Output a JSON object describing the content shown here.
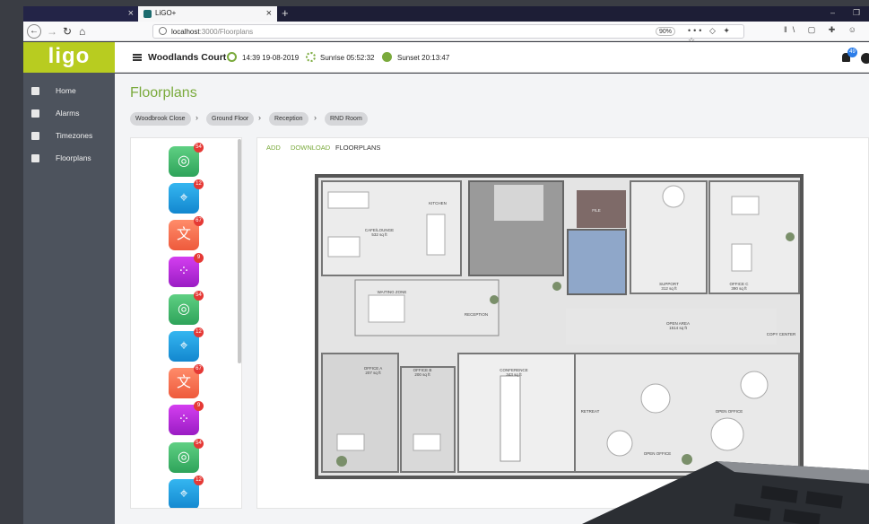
{
  "browser": {
    "tab_title": "LiGO+",
    "url_host": "localhost",
    "url_path": ":3000/Floorplans",
    "zoom": "90%"
  },
  "sidebar": {
    "logo": "ligo",
    "items": [
      {
        "label": "Home"
      },
      {
        "label": "Alarms"
      },
      {
        "label": "Timezones"
      },
      {
        "label": "Floorplans"
      }
    ]
  },
  "header": {
    "site_name": "Woodlands Court",
    "time": "14:39 19-08-2019",
    "sunrise": "Sunrise 05:52:32",
    "sunset": "Sunset 20:13:47",
    "notification_count": "49"
  },
  "main": {
    "title": "Floorplans",
    "breadcrumbs": [
      "Woodbrook Close",
      "Ground Floor",
      "Reception",
      "RND Room"
    ],
    "tabs": [
      "ADD",
      "DOWNLOAD",
      "FLOORPLANS"
    ],
    "colors": {
      "accent": "#7aaa3c",
      "logo_bg": "#b8cc20",
      "sidebar_bg": "#4d535d"
    },
    "devices": [
      {
        "type": "fingerprint",
        "icon": "fingerprint-icon",
        "badge": "54"
      },
      {
        "type": "wireless",
        "icon": "wireless-reader-icon",
        "badge": "12"
      },
      {
        "type": "translate",
        "icon": "translate-icon",
        "badge": "67"
      },
      {
        "type": "keypad",
        "icon": "keypad-icon",
        "badge": "9"
      },
      {
        "type": "fingerprint",
        "icon": "fingerprint-icon",
        "badge": "54"
      },
      {
        "type": "wireless",
        "icon": "wireless-reader-icon",
        "badge": "12"
      },
      {
        "type": "translate",
        "icon": "translate-icon",
        "badge": "67"
      },
      {
        "type": "keypad",
        "icon": "keypad-icon",
        "badge": "9"
      },
      {
        "type": "fingerprint",
        "icon": "fingerprint-icon",
        "badge": "54"
      },
      {
        "type": "wireless",
        "icon": "wireless-reader-icon",
        "badge": "12"
      }
    ],
    "rooms": {
      "kitchen": "KITCHEN",
      "cafe": "CAFE/LOUNGE",
      "cafe_area": "532 sq ft",
      "file": "FILE",
      "support": "SUPPORT",
      "support_area": "312 sq ft",
      "office_c": "OFFICE C",
      "office_c_area": "390 sq ft",
      "waiting": "WAITING ZONE",
      "reception": "RECEPTION",
      "open_area": "OPEN AREA",
      "open_area_sqft": "1514 sq ft",
      "copy": "COPY CENTER",
      "office_a": "OFFICE A",
      "office_a_area": "207 sq ft",
      "office_b": "OFFICE B",
      "office_b_area": "200 sq ft",
      "conference": "CONFERENCE",
      "conference_area": "343 sq ft",
      "retreat": "RETREAT",
      "open_office": "OPEN OFFICE",
      "open_office_2": "OPEN OFFICE"
    }
  }
}
